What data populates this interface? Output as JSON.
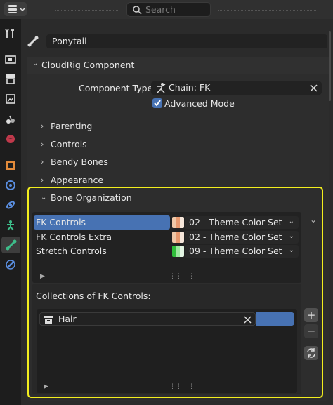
{
  "header": {
    "search_placeholder": "Search"
  },
  "sidebar": {
    "tabs": [
      {
        "icon": "tool-icon"
      },
      {
        "icon": "render-icon"
      },
      {
        "icon": "output-icon"
      },
      {
        "icon": "view-layer-icon"
      },
      {
        "icon": "scene-icon"
      },
      {
        "icon": "world-icon"
      },
      {
        "icon": "object-icon"
      },
      {
        "icon": "modifier-icon"
      },
      {
        "icon": "physics-icon"
      },
      {
        "icon": "armature-data-icon"
      },
      {
        "icon": "bone-icon",
        "active": true
      },
      {
        "icon": "bone-constraint-icon"
      }
    ]
  },
  "bone": {
    "name": "Ponytail"
  },
  "panel": {
    "title": "CloudRig Component",
    "component_type_label": "Component Type",
    "component_type_value": "Chain: FK",
    "advanced_mode_label": "Advanced Mode",
    "advanced_mode_checked": true,
    "subpanels": [
      "Parenting",
      "Controls",
      "Bendy Bones",
      "Appearance"
    ],
    "bone_org_title": "Bone Organization"
  },
  "bone_sets": [
    {
      "name": "FK Controls",
      "theme": "02 - Theme Color Set",
      "selected": true,
      "colors": [
        "#f0c8a8",
        "#e89a70",
        "#f6e6da"
      ]
    },
    {
      "name": "FK Controls Extra",
      "theme": "02 - Theme Color Set",
      "selected": false,
      "colors": [
        "#f0c8a8",
        "#e89a70",
        "#f6e6da"
      ]
    },
    {
      "name": "Stretch Controls",
      "theme": "09 - Theme Color Set",
      "selected": false,
      "colors": [
        "#2fbf3a",
        "#9ce89e",
        "#e4f6e4"
      ]
    }
  ],
  "collections": {
    "label": "Collections of FK Controls:",
    "items": [
      {
        "name": "Hair"
      }
    ]
  },
  "colors": {
    "accent": "#4772b3",
    "highlight": "#f2ee1e"
  }
}
